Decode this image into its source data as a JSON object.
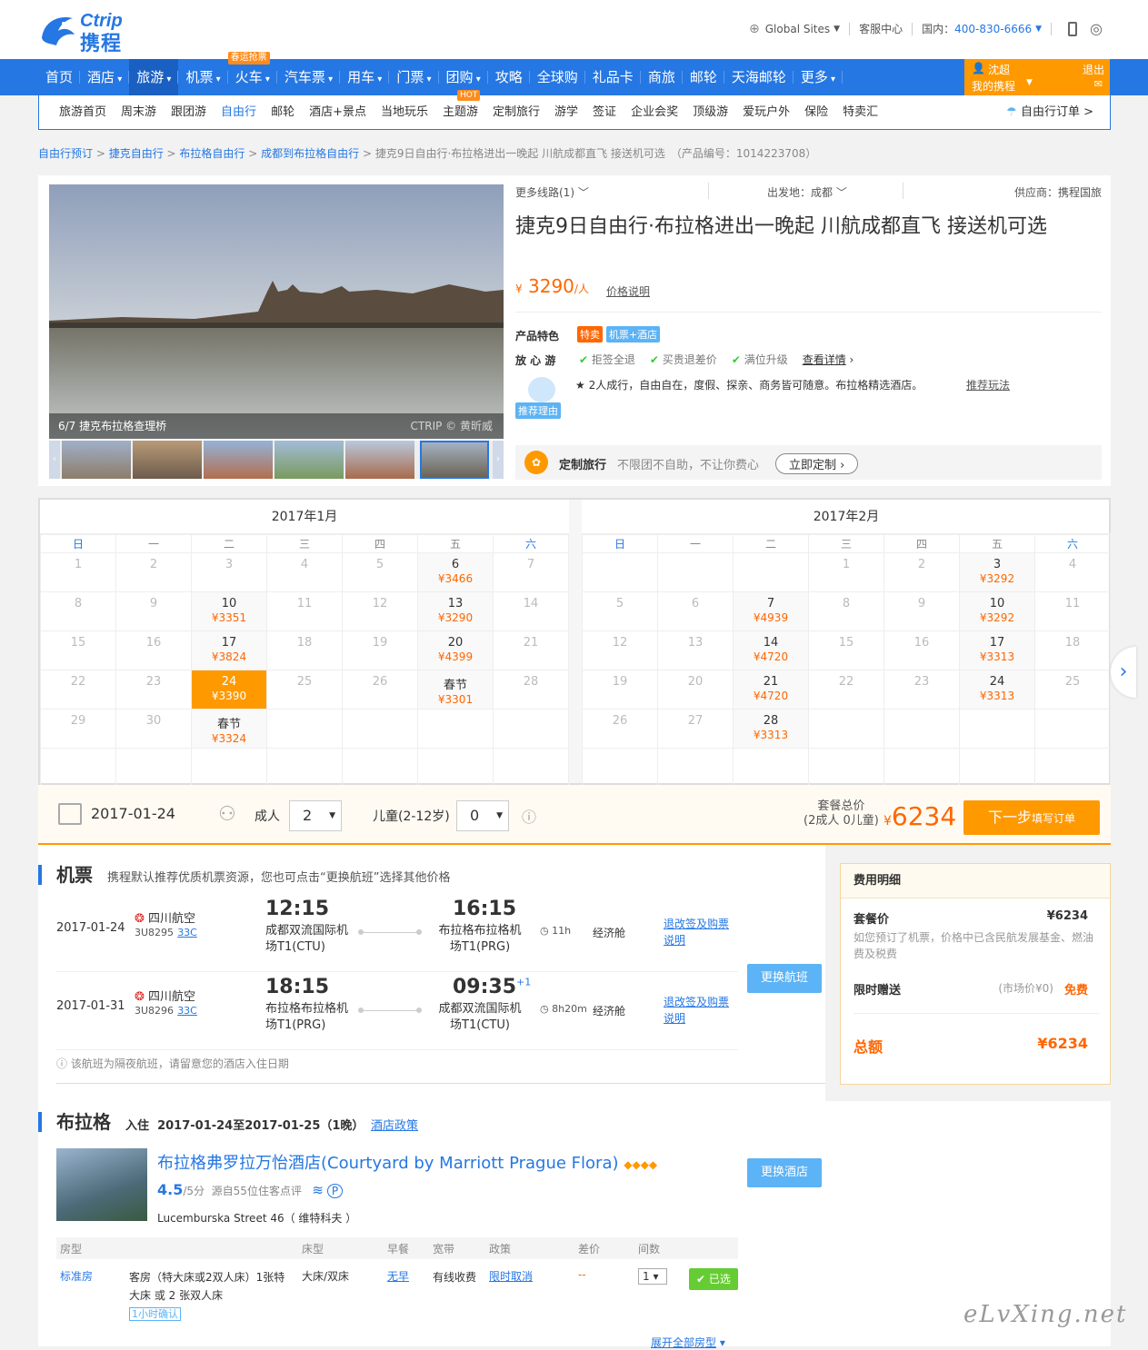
{
  "header": {
    "logo_en": "Ctrip",
    "logo_cn": "携程",
    "global_sites": "Global Sites",
    "service": "客服中心",
    "phone_label": "国内：",
    "phone": "400-830-6666"
  },
  "nav": {
    "items": [
      "首页",
      "酒店",
      "旅游",
      "机票",
      "火车",
      "汽车票",
      "用车",
      "门票",
      "团购",
      "攻略",
      "全球购",
      "礼品卡",
      "商旅",
      "邮轮",
      "天海邮轮",
      "更多"
    ],
    "train_tag": "春运抢票",
    "user_name": "沈超",
    "my_trip": "我的携程",
    "logout": "退出"
  },
  "subnav": {
    "items": [
      "旅游首页",
      "周末游",
      "跟团游",
      "自由行",
      "邮轮",
      "酒店+景点",
      "当地玩乐",
      "主题游",
      "定制旅行",
      "游学",
      "签证",
      "企业会奖",
      "顶级游",
      "爱玩户外",
      "保险",
      "特卖汇"
    ],
    "hot_tag": "HOT",
    "orders": "自由行订单 >"
  },
  "breadcrumb": {
    "links": [
      "自由行预订",
      "捷克自由行",
      "布拉格自由行",
      "成都到布拉格自由行"
    ],
    "current": "捷克9日自由行·布拉格进出一晚起 川航成都直飞 接送机可选",
    "product_no": "（产品编号：1014223708）"
  },
  "product": {
    "image_caption": "6/7  捷克布拉格查理桥",
    "image_watermark": "CTRIP © 黄昕威",
    "more_routes": "更多线路(1)",
    "departure": "出发地：成都",
    "supplier": "供应商：携程国旅",
    "title": "捷克9日自由行·布拉格进出一晚起 川航成都直飞 接送机可选",
    "currency": "¥",
    "price": "3290",
    "price_unit": "/人",
    "price_note": "价格说明",
    "feature_label": "产品特色",
    "feature_tags": [
      "特卖",
      "机票+酒店"
    ],
    "assure_label": "放 心 游",
    "assure_items": [
      "拒签全退",
      "买贵退差价",
      "满位升级"
    ],
    "assure_more": "查看详情",
    "reason_badge": "推荐理由",
    "reason_text": "★ 2人成行，自由自在，度假、探亲、商务皆可随意。布拉格精选酒店。",
    "reason_link": "推荐玩法",
    "custom_title": "定制旅行",
    "custom_text": "不限团不自助，不让你费心",
    "custom_btn": "立即定制"
  },
  "calendar": {
    "weekdays": [
      "日",
      "一",
      "二",
      "三",
      "四",
      "五",
      "六"
    ],
    "months": [
      {
        "title": "2017年1月",
        "weeks": [
          [
            {
              "d": "1"
            },
            {
              "d": "2"
            },
            {
              "d": "3"
            },
            {
              "d": "4"
            },
            {
              "d": "5"
            },
            {
              "d": "6",
              "p": "¥3466"
            },
            {
              "d": "7"
            }
          ],
          [
            {
              "d": "8"
            },
            {
              "d": "9"
            },
            {
              "d": "10",
              "p": "¥3351"
            },
            {
              "d": "11"
            },
            {
              "d": "12"
            },
            {
              "d": "13",
              "p": "¥3290"
            },
            {
              "d": "14"
            }
          ],
          [
            {
              "d": "15"
            },
            {
              "d": "16"
            },
            {
              "d": "17",
              "p": "¥3824"
            },
            {
              "d": "18"
            },
            {
              "d": "19"
            },
            {
              "d": "20",
              "p": "¥4399"
            },
            {
              "d": "21"
            }
          ],
          [
            {
              "d": "22"
            },
            {
              "d": "23"
            },
            {
              "d": "24",
              "p": "¥3390",
              "sel": true
            },
            {
              "d": "25"
            },
            {
              "d": "26"
            },
            {
              "d": "春节",
              "p": "¥3301"
            },
            {
              "d": "28"
            }
          ],
          [
            {
              "d": "29"
            },
            {
              "d": "30"
            },
            {
              "d": "春节",
              "p": "¥3324"
            },
            {
              "d": ""
            },
            {
              "d": ""
            },
            {
              "d": ""
            },
            {
              "d": ""
            }
          ],
          [
            {
              "d": ""
            },
            {
              "d": ""
            },
            {
              "d": ""
            },
            {
              "d": ""
            },
            {
              "d": ""
            },
            {
              "d": ""
            },
            {
              "d": ""
            }
          ]
        ]
      },
      {
        "title": "2017年2月",
        "weeks": [
          [
            {
              "d": ""
            },
            {
              "d": ""
            },
            {
              "d": ""
            },
            {
              "d": "1"
            },
            {
              "d": "2"
            },
            {
              "d": "3",
              "p": "¥3292"
            },
            {
              "d": "4"
            }
          ],
          [
            {
              "d": "5"
            },
            {
              "d": "6"
            },
            {
              "d": "7",
              "p": "¥4939"
            },
            {
              "d": "8"
            },
            {
              "d": "9"
            },
            {
              "d": "10",
              "p": "¥3292"
            },
            {
              "d": "11"
            }
          ],
          [
            {
              "d": "12"
            },
            {
              "d": "13"
            },
            {
              "d": "14",
              "p": "¥4720"
            },
            {
              "d": "15"
            },
            {
              "d": "16"
            },
            {
              "d": "17",
              "p": "¥3313"
            },
            {
              "d": "18"
            }
          ],
          [
            {
              "d": "19"
            },
            {
              "d": "20"
            },
            {
              "d": "21",
              "p": "¥4720"
            },
            {
              "d": "22"
            },
            {
              "d": "23"
            },
            {
              "d": "24",
              "p": "¥3313"
            },
            {
              "d": "25"
            }
          ],
          [
            {
              "d": "26"
            },
            {
              "d": "27"
            },
            {
              "d": "28",
              "p": "¥3313"
            },
            {
              "d": ""
            },
            {
              "d": ""
            },
            {
              "d": ""
            },
            {
              "d": ""
            }
          ],
          [
            {
              "d": ""
            },
            {
              "d": ""
            },
            {
              "d": ""
            },
            {
              "d": ""
            },
            {
              "d": ""
            },
            {
              "d": ""
            },
            {
              "d": ""
            }
          ]
        ]
      }
    ]
  },
  "booking": {
    "date": "2017-01-24",
    "adult_label": "成人",
    "adults": "2",
    "child_label": "儿童(2-12岁)",
    "children": "0",
    "total_label": "套餐总价",
    "total_sub": "(2成人 0儿童)",
    "currency": "¥",
    "total": "6234",
    "next_btn": "下一步",
    "next_sub": "填写订单"
  },
  "flights": {
    "title": "机票",
    "desc": "携程默认推荐优质机票资源，您也可点击“更换航班”选择其他价格",
    "rows": [
      {
        "date": "2017-01-24",
        "airline": "四川航空",
        "no": "3U8295",
        "plane": "33C",
        "dep_time": "12:15",
        "dep_ap": "成都双流国际机场T1(CTU)",
        "arr_time": "16:15",
        "arr_plus": "",
        "arr_ap": "布拉格布拉格机场T1(PRG)",
        "dur": "11h",
        "cls": "经济舱",
        "rule": "退改签及购票说明"
      },
      {
        "date": "2017-01-31",
        "airline": "四川航空",
        "no": "3U8296",
        "plane": "33C",
        "dep_time": "18:15",
        "dep_ap": "布拉格布拉格机场T1(PRG)",
        "arr_time": "09:35",
        "arr_plus": "+1",
        "arr_ap": "成都双流国际机场T1(CTU)",
        "dur": "8h20m",
        "cls": "经济舱",
        "rule": "退改签及购票说明"
      }
    ],
    "change_btn": "更换航班",
    "note": "该航班为隔夜航班，请留意您的酒店入住日期"
  },
  "fees": {
    "title": "费用明细",
    "pkg_label": "套餐价",
    "pkg_value": "¥6234",
    "pkg_note": "如您预订了机票，价格中已含民航发展基金、燃油费及税费",
    "gift_label": "限时赠送",
    "gift_market": "(市场价¥0)",
    "gift_value": "免费",
    "total_label": "总额",
    "total_value": "¥6234"
  },
  "hotel": {
    "city": "布拉格",
    "stay_label": "入住",
    "stay": "2017-01-24至2017-01-25（1晚）",
    "policy": "酒店政策",
    "name": "布拉格弗罗拉万怡酒店(Courtyard by Marriott Prague Flora)",
    "score": "4.5",
    "score_unit": "/5分",
    "reviews": "源自55位住客点评",
    "address": "Lucemburska Street 46（ 维特科夫 ）",
    "change_btn": "更换酒店",
    "headers": [
      "房型",
      "",
      "床型",
      "早餐",
      "宽带",
      "政策",
      "差价",
      "间数"
    ],
    "room": {
      "type": "标准房",
      "desc": "客房（特大床或2双人床）1张特大床 或 2 张双人床",
      "confirm": "1小时确认",
      "bed": "大床/双床",
      "breakfast": "无早",
      "net": "有线收费",
      "policy": "限时取消",
      "diff": "--",
      "count": "1",
      "chosen": "已选"
    },
    "expand": "展开全部房型"
  },
  "watermark": "eLvXing.net"
}
